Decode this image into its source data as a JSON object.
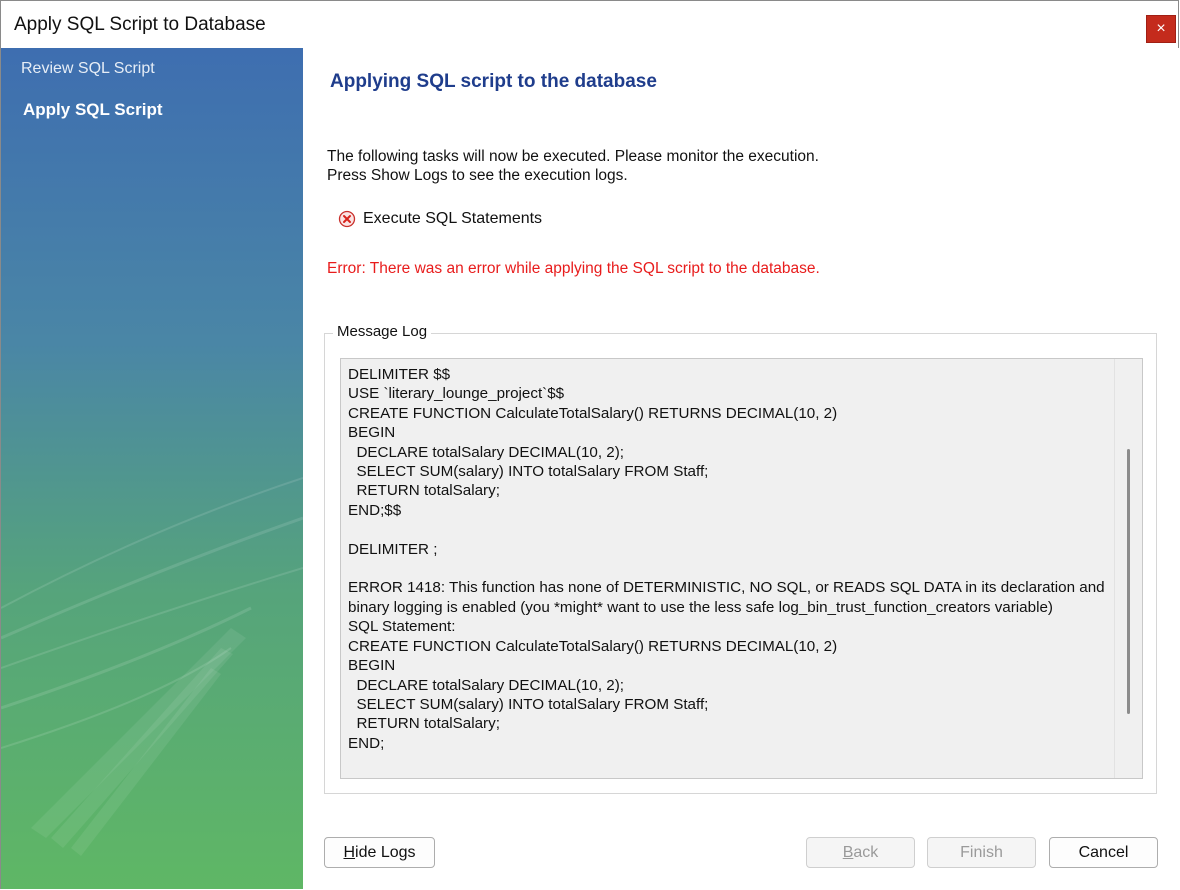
{
  "window": {
    "title": "Apply SQL Script to Database",
    "close_glyph": "×"
  },
  "sidebar": {
    "items": [
      {
        "label": "Review SQL Script",
        "active": false
      },
      {
        "label": "Apply SQL Script",
        "active": true
      }
    ]
  },
  "main": {
    "heading": "Applying SQL script to the database",
    "intro_line1": "The following tasks will now be executed. Please monitor the execution.",
    "intro_line2": "Press Show Logs to see the execution logs.",
    "task": {
      "label": "Execute SQL Statements",
      "status_icon": "error-x-icon"
    },
    "error_message": "Error: There was an error while applying the SQL script to the database."
  },
  "message_log": {
    "label": "Message Log",
    "text": "DELIMITER $$\nUSE `literary_lounge_project`$$\nCREATE FUNCTION CalculateTotalSalary() RETURNS DECIMAL(10, 2)\nBEGIN\n  DECLARE totalSalary DECIMAL(10, 2);\n  SELECT SUM(salary) INTO totalSalary FROM Staff;\n  RETURN totalSalary;\nEND;$$\n\nDELIMITER ;\n\nERROR 1418: This function has none of DETERMINISTIC, NO SQL, or READS SQL DATA in its declaration and binary logging is enabled (you *might* want to use the less safe log_bin_trust_function_creators variable)\nSQL Statement:\nCREATE FUNCTION CalculateTotalSalary() RETURNS DECIMAL(10, 2)\nBEGIN\n  DECLARE totalSalary DECIMAL(10, 2);\n  SELECT SUM(salary) INTO totalSalary FROM Staff;\n  RETURN totalSalary;\nEND;"
  },
  "buttons": {
    "hide_logs_prefix": "H",
    "hide_logs_rest": "ide Logs",
    "back_prefix": "B",
    "back_rest": "ack",
    "finish": "Finish",
    "cancel": "Cancel"
  },
  "colors": {
    "heading": "#1f3d8c",
    "error": "#e81c1c",
    "close_button": "#c42b1c"
  }
}
